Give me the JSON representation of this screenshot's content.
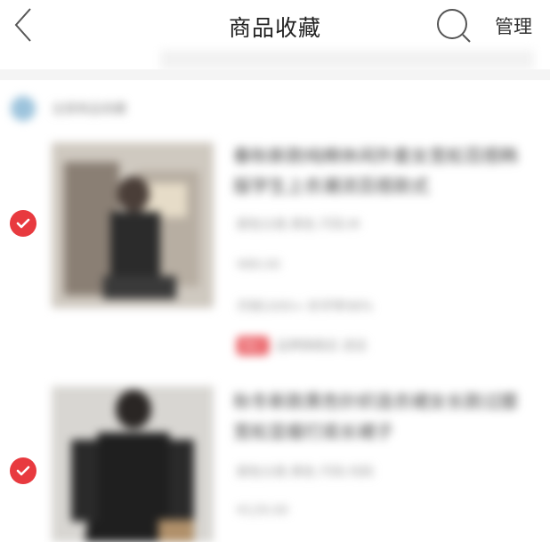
{
  "nav": {
    "title": "商品收藏",
    "manage_label": "管理"
  },
  "icons": {
    "back": "chevron-left-icon",
    "search": "search-icon",
    "check": "check-circle-icon"
  },
  "colors": {
    "accent_red": "#e83a3f",
    "group_dot": "#9cc3dc"
  },
  "group": {
    "label": "全部商品收藏"
  },
  "items": [
    {
      "title": "春秋新款纯棉休闲外套女宽松百搭韩版学生上衣潮流百搭款式",
      "spec": "颜色分类:黑色 尺码:M",
      "price": "¥89.00",
      "sales": "月销1000+ 好评率98%",
      "tag": "降价",
      "shop": "品牌旗舰店 进店",
      "checked": true
    },
    {
      "title": "秋冬新款黑色针织连衣裙女长款过膝宽松显瘦打底长裙子",
      "spec": "颜色分类:黑色 尺码:均码",
      "price": "¥129.00",
      "checked": true
    }
  ]
}
